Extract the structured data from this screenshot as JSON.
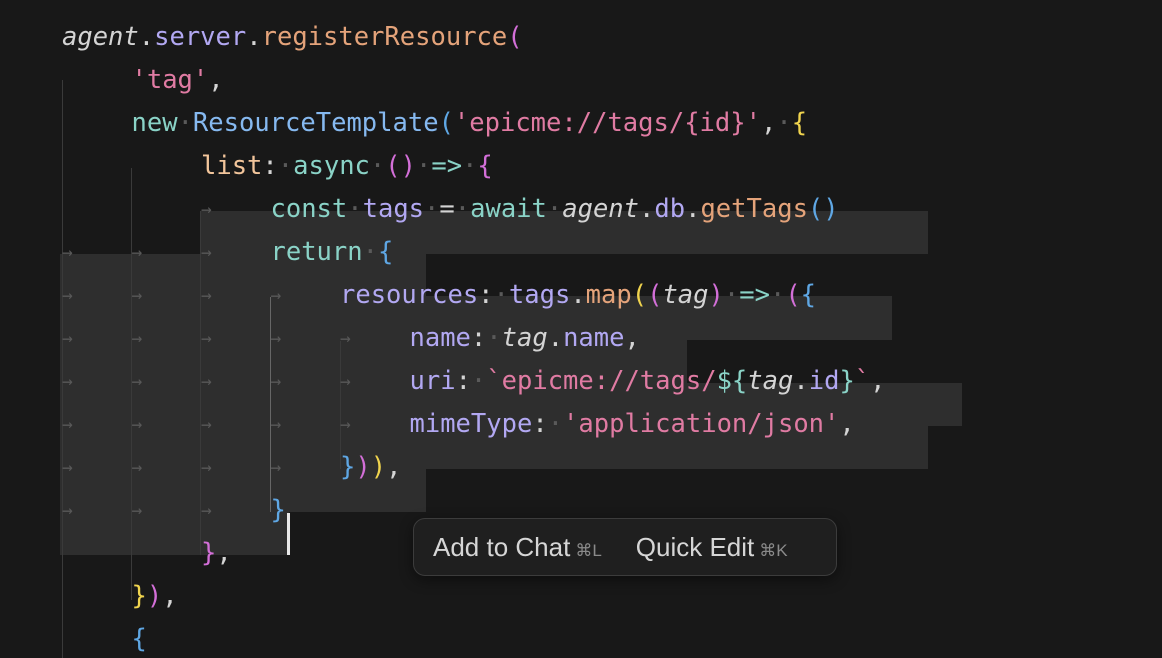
{
  "code": {
    "lines": [
      [
        [
          "agent",
          "#d4d4d4",
          "i"
        ],
        [
          ".",
          "#d4d4d4"
        ],
        [
          "server",
          "#b2a8f2"
        ],
        [
          ".",
          "#d4d4d4"
        ],
        [
          "registerResource",
          "#e4a37a"
        ],
        [
          "(",
          "#d36fd8"
        ]
      ],
      [
        [
          "'tag'",
          "#e07ba3"
        ],
        [
          ",",
          "#d4d4d4"
        ]
      ],
      [
        [
          "new",
          "#8ad3c7"
        ],
        [
          "·",
          "#5a5a5a"
        ],
        [
          "ResourceTemplate",
          "#86b9f0"
        ],
        [
          "(",
          "#5fa7e4"
        ],
        [
          "'epicme://tags/{id}'",
          "#e07ba3"
        ],
        [
          ",",
          "#d4d4d4"
        ],
        [
          "·",
          "#5a5a5a"
        ],
        [
          "{",
          "#f0d44e"
        ]
      ],
      [
        [
          "list",
          "#f2c59b"
        ],
        [
          ":",
          "#d4d4d4"
        ],
        [
          "·",
          "#5a5a5a"
        ],
        [
          "async",
          "#8ad3c7"
        ],
        [
          "·",
          "#5a5a5a"
        ],
        [
          "()",
          "#d36fd8"
        ],
        [
          "·",
          "#5a5a5a"
        ],
        [
          "=>",
          "#8ad3c7"
        ],
        [
          "·",
          "#5a5a5a"
        ],
        [
          "{",
          "#d36fd8"
        ]
      ],
      [
        [
          "const",
          "#8ad3c7"
        ],
        [
          "·",
          "#5a5a5a"
        ],
        [
          "tags",
          "#b2a8f2"
        ],
        [
          "·",
          "#5a5a5a"
        ],
        [
          "=",
          "#d4d4d4"
        ],
        [
          "·",
          "#5a5a5a"
        ],
        [
          "await",
          "#8ad3c7"
        ],
        [
          "·",
          "#5a5a5a"
        ],
        [
          "agent",
          "#d4d4d4",
          "i"
        ],
        [
          ".",
          "#d4d4d4"
        ],
        [
          "db",
          "#b2a8f2"
        ],
        [
          ".",
          "#d4d4d4"
        ],
        [
          "getTags",
          "#e4a37a"
        ],
        [
          "()",
          "#5fa7e4"
        ]
      ],
      [
        [
          "return",
          "#8ad3c7"
        ],
        [
          "·",
          "#5a5a5a"
        ],
        [
          "{",
          "#5fa7e4"
        ]
      ],
      [
        [
          "resources",
          "#b2a8f2"
        ],
        [
          ":",
          "#d4d4d4"
        ],
        [
          "·",
          "#5a5a5a"
        ],
        [
          "tags",
          "#b2a8f2"
        ],
        [
          ".",
          "#d4d4d4"
        ],
        [
          "map",
          "#e4a37a"
        ],
        [
          "(",
          "#f0d44e"
        ],
        [
          "(",
          "#d36fd8"
        ],
        [
          "tag",
          "#d4d4d4",
          "i"
        ],
        [
          ")",
          "#d36fd8"
        ],
        [
          "·",
          "#5a5a5a"
        ],
        [
          "=>",
          "#8ad3c7"
        ],
        [
          "·",
          "#5a5a5a"
        ],
        [
          "(",
          "#d36fd8"
        ],
        [
          "{",
          "#5fa7e4"
        ]
      ],
      [
        [
          "name",
          "#b2a8f2"
        ],
        [
          ":",
          "#d4d4d4"
        ],
        [
          "·",
          "#5a5a5a"
        ],
        [
          "tag",
          "#d4d4d4",
          "i"
        ],
        [
          ".",
          "#d4d4d4"
        ],
        [
          "name",
          "#b2a8f2"
        ],
        [
          ",",
          "#d4d4d4"
        ]
      ],
      [
        [
          "uri",
          "#b2a8f2"
        ],
        [
          ":",
          "#d4d4d4"
        ],
        [
          "·",
          "#5a5a5a"
        ],
        [
          "`epicme://tags/",
          "#e07ba3"
        ],
        [
          "${",
          "#8ad3c7"
        ],
        [
          "tag",
          "#d4d4d4",
          "i"
        ],
        [
          ".",
          "#d4d4d4"
        ],
        [
          "id",
          "#b2a8f2"
        ],
        [
          "}",
          "#8ad3c7"
        ],
        [
          "`",
          "#e07ba3"
        ],
        [
          ",",
          "#d4d4d4"
        ]
      ],
      [
        [
          "mimeType",
          "#b2a8f2"
        ],
        [
          ":",
          "#d4d4d4"
        ],
        [
          "·",
          "#5a5a5a"
        ],
        [
          "'application/json'",
          "#e07ba3"
        ],
        [
          ",",
          "#d4d4d4"
        ]
      ],
      [
        [
          "}",
          "#5fa7e4"
        ],
        [
          ")",
          "#d36fd8"
        ],
        [
          ")",
          "#f0d44e"
        ],
        [
          ",",
          "#d4d4d4"
        ]
      ],
      [
        [
          "}",
          "#5fa7e4"
        ]
      ],
      [
        [
          "}",
          "#d36fd8"
        ],
        [
          ",",
          "#d4d4d4"
        ]
      ],
      [
        [
          "}",
          "#f0d44e"
        ],
        [
          ")",
          "#d36fd8"
        ],
        [
          ",",
          "#d4d4d4"
        ]
      ],
      [
        [
          "{",
          "#5fa7e4"
        ]
      ]
    ]
  },
  "popup": {
    "add_to_chat_label": "Add to Chat",
    "add_to_chat_shortcut": "⌘L",
    "quick_edit_label": "Quick Edit",
    "quick_edit_shortcut": "⌘K"
  }
}
